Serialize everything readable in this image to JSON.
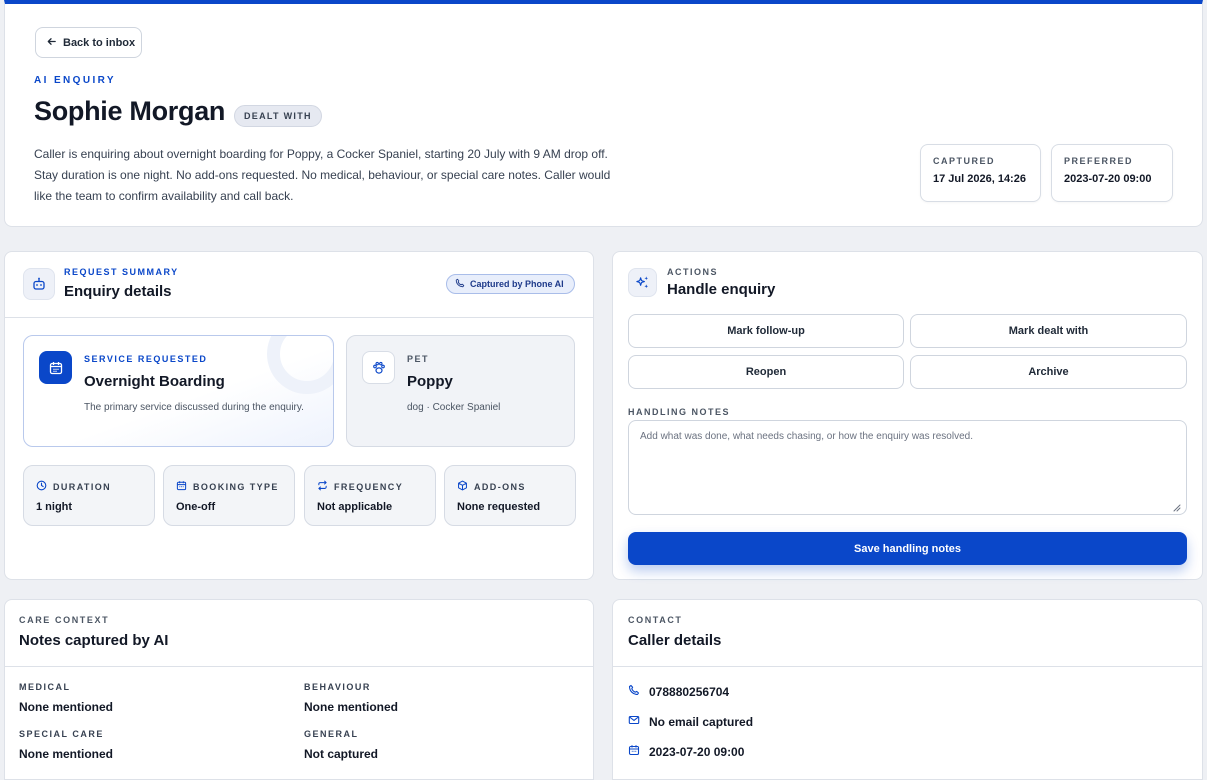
{
  "header": {
    "back_label": "Back to inbox",
    "eyebrow": "AI ENQUIRY",
    "name": "Sophie Morgan",
    "status": "DEALT WITH",
    "summary": "Caller is enquiring about overnight boarding for Poppy, a Cocker Spaniel, starting 20 July with 9 AM drop off. Stay duration is one night. No add-ons requested. No medical, behaviour, or special care notes. Caller would like the team to confirm availability and call back.",
    "captured_label": "CAPTURED",
    "captured_value": "17 Jul 2026, 14:26",
    "preferred_label": "PREFERRED",
    "preferred_value": "2023-07-20 09:00"
  },
  "details": {
    "eyebrow": "REQUEST SUMMARY",
    "title": "Enquiry details",
    "source_pill": "Captured by Phone AI",
    "service": {
      "eyebrow": "SERVICE REQUESTED",
      "title": "Overnight Boarding",
      "desc": "The primary service discussed during the enquiry."
    },
    "pet": {
      "eyebrow": "PET",
      "name": "Poppy",
      "desc": "dog · Cocker Spaniel"
    },
    "stats": [
      {
        "label": "DURATION",
        "value": "1 night",
        "icon": "clock-icon"
      },
      {
        "label": "BOOKING TYPE",
        "value": "One-off",
        "icon": "calendar-icon"
      },
      {
        "label": "FREQUENCY",
        "value": "Not applicable",
        "icon": "repeat-icon"
      },
      {
        "label": "ADD-ONS",
        "value": "None requested",
        "icon": "box-icon"
      }
    ]
  },
  "actions": {
    "eyebrow": "ACTIONS",
    "title": "Handle enquiry",
    "buttons": {
      "follow_up": "Mark follow-up",
      "dealt_with": "Mark dealt with",
      "reopen": "Reopen",
      "archive": "Archive"
    },
    "notes_label": "HANDLING NOTES",
    "notes_placeholder": "Add what was done, what needs chasing, or how the enquiry was resolved.",
    "save_label": "Save handling notes"
  },
  "care": {
    "eyebrow": "CARE CONTEXT",
    "title": "Notes captured by AI",
    "fields": [
      {
        "label": "MEDICAL",
        "value": "None mentioned"
      },
      {
        "label": "BEHAVIOUR",
        "value": "None mentioned"
      },
      {
        "label": "SPECIAL CARE",
        "value": "None mentioned"
      },
      {
        "label": "GENERAL",
        "value": "Not captured"
      }
    ]
  },
  "contact": {
    "eyebrow": "CONTACT",
    "title": "Caller details",
    "phone": "078880256704",
    "email": "No email captured",
    "date": "2023-07-20 09:00"
  },
  "colors": {
    "accent": "#0a47c9",
    "background": "#eef0f4",
    "text": "#121826"
  }
}
